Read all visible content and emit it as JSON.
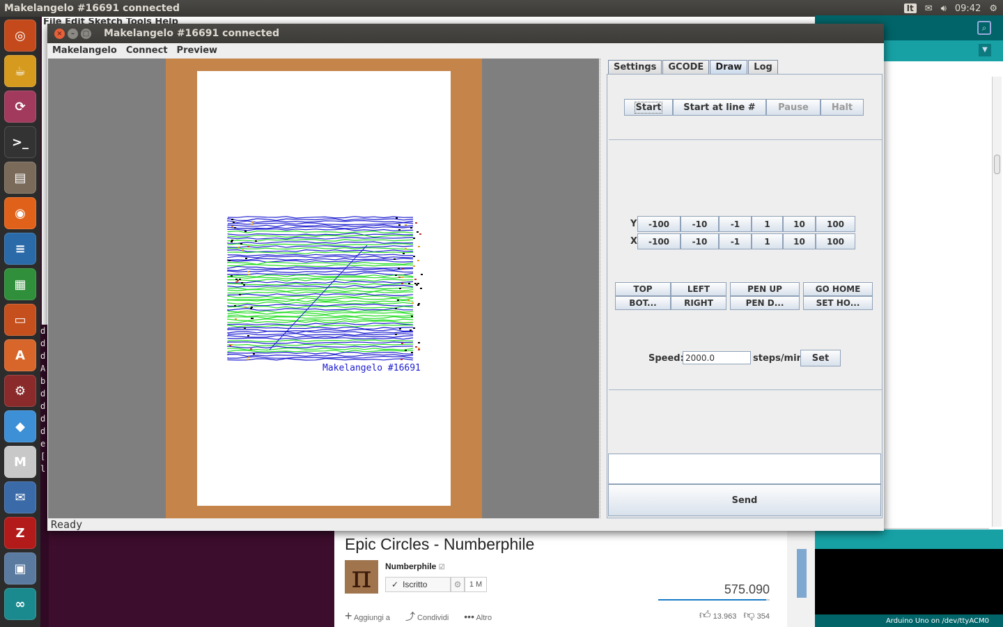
{
  "top_panel": {
    "title": "Makelangelo #16691 connected",
    "keyboard_layout": "It",
    "clock": "09:42"
  },
  "launcher": {
    "items": [
      {
        "name": "ubuntu-dash-icon",
        "glyph": "◎",
        "color": "#c44a1c"
      },
      {
        "name": "teapot-icon",
        "glyph": "☕",
        "color": "#d59a1e"
      },
      {
        "name": "sync-icon",
        "glyph": "⟳",
        "color": "#a13a5c"
      },
      {
        "name": "terminal-icon",
        "glyph": ">_",
        "color": "#333333"
      },
      {
        "name": "file-manager-icon",
        "glyph": "▤",
        "color": "#7a6a5a"
      },
      {
        "name": "firefox-icon",
        "glyph": "◉",
        "color": "#e0621a"
      },
      {
        "name": "writer-icon",
        "glyph": "≡",
        "color": "#2a6aa8"
      },
      {
        "name": "calc-icon",
        "glyph": "▦",
        "color": "#2f8f3a"
      },
      {
        "name": "impress-icon",
        "glyph": "▭",
        "color": "#c5501e"
      },
      {
        "name": "software-center-icon",
        "glyph": "A",
        "color": "#d8662a"
      },
      {
        "name": "system-settings-icon",
        "glyph": "⚙",
        "color": "#8a2a2a"
      },
      {
        "name": "dropbox-icon",
        "glyph": "◆",
        "color": "#3d8fd6"
      },
      {
        "name": "gmail-icon",
        "glyph": "M",
        "color": "#c8c8c8"
      },
      {
        "name": "thunderbird-icon",
        "glyph": "✉",
        "color": "#3a6aa8"
      },
      {
        "name": "filezilla-icon",
        "glyph": "Z",
        "color": "#b31a1a"
      },
      {
        "name": "remote-desktop-icon",
        "glyph": "▣",
        "color": "#5a7aa0"
      },
      {
        "name": "arduino-icon",
        "glyph": "∞",
        "color": "#1a8a8e"
      }
    ]
  },
  "background_menu": "File  Edit  Sketch  Tools  Help",
  "arduino": {
    "status": "Arduino Uno on /dev/ttyACM0"
  },
  "youtube": {
    "video_title": "Epic Circles - Numberphile",
    "channel": "Numberphile",
    "subscribe_label": "Iscritto",
    "subscriber_count": "1 M",
    "views": "575.090",
    "add_label": "Aggiungi a",
    "share_label": "Condividi",
    "more_label": "Altro",
    "likes": "13.963",
    "dislikes": "354"
  },
  "makelangelo": {
    "window_title": "Makelangelo #16691 connected",
    "menu": [
      "Makelangelo",
      "Connect",
      "Preview"
    ],
    "drawing_signature": "Makelangelo #16691",
    "status": "Ready",
    "tabs": [
      "Settings",
      "GCODE",
      "Draw",
      "Log"
    ],
    "active_tab": "Draw",
    "run_buttons": {
      "start": "Start",
      "start_at_line": "Start at line #",
      "pause": "Pause",
      "halt": "Halt"
    },
    "jog": {
      "y_label": "Y",
      "x_label": "X",
      "steps": [
        "-100",
        "-10",
        "-1",
        "1",
        "10",
        "100"
      ]
    },
    "position_buttons": {
      "top": "TOP",
      "bottom": "BOT...",
      "left": "LEFT",
      "right": "RIGHT",
      "pen_up": "PEN UP",
      "pen_down": "PEN D...",
      "go_home": "GO HOME",
      "set_home": "SET HO..."
    },
    "speed": {
      "label": "Speed:",
      "value": "2000.0",
      "unit": "steps/min",
      "set_label": "Set"
    },
    "send_label": "Send"
  },
  "colors": {
    "machine": "#c4844a",
    "canvas_bg": "#7f7f7f",
    "paper": "#ffffff",
    "path_green": "#22dd22",
    "path_blue": "#1a1ad0",
    "arduino_teal": "#17a1a5"
  }
}
